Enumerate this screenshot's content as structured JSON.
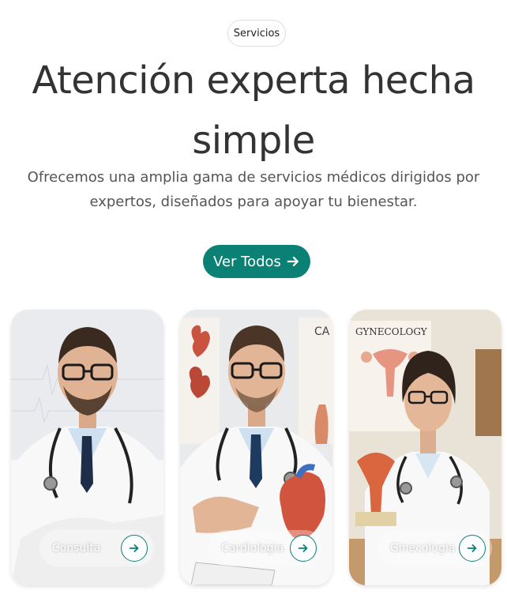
{
  "section_badge": "Servicios",
  "heading": {
    "line1": "Atención experta hecha",
    "line2": "simple"
  },
  "subtitle": {
    "line1": "Ofrecemos una amplia gama de servicios médicos dirigidos por",
    "line2": "expertos, diseñados para apoyar tu bienestar."
  },
  "cta": {
    "label": "Ver Todos",
    "icon": "arrow-right-icon"
  },
  "cards": [
    {
      "label": "Consulta",
      "icon": "arrow-right-circle-icon",
      "poster": ""
    },
    {
      "label": "Cardiologia",
      "icon": "arrow-right-circle-icon",
      "poster": "CA"
    },
    {
      "label": "Ginecologia",
      "icon": "arrow-right-circle-icon",
      "poster": "GYNECOLOGY"
    }
  ],
  "colors": {
    "accent": "#0b8075",
    "text": "#333333",
    "muted": "#555555"
  }
}
